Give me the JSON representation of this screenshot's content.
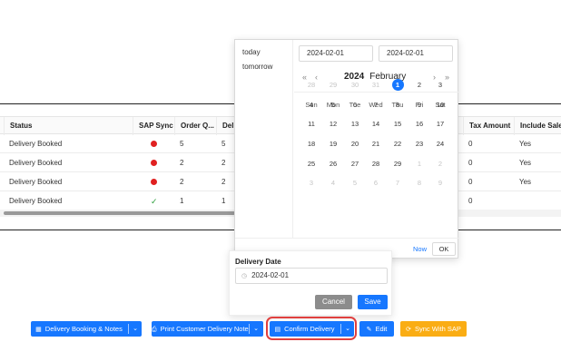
{
  "table": {
    "headers": [
      "Status",
      "SAP Sync",
      "Order Q...",
      "Deliv",
      "Tax Amount",
      "Include Sales"
    ],
    "rows": [
      {
        "status": "Delivery Booked",
        "sync": "error",
        "order_qty": "5",
        "deliv": "5",
        "tax": "0",
        "include": "Yes"
      },
      {
        "status": "Delivery Booked",
        "sync": "error",
        "order_qty": "2",
        "deliv": "2",
        "tax": "0",
        "include": "Yes"
      },
      {
        "status": "Delivery Booked",
        "sync": "error",
        "order_qty": "2",
        "deliv": "2",
        "tax": "0",
        "include": "Yes"
      },
      {
        "status": "Delivery Booked",
        "sync": "ok",
        "order_qty": "1",
        "deliv": "1",
        "tax": "0",
        "include": ""
      }
    ]
  },
  "picker": {
    "presets": [
      "today",
      "tomorrow"
    ],
    "range_start": "2024-02-01",
    "range_end": "2024-02-01",
    "year": "2024",
    "month": "February",
    "nav": {
      "prev_year": "«",
      "prev_month": "‹",
      "next_month": "›",
      "next_year": "»"
    },
    "weekdays": [
      "Sun",
      "Mon",
      "Tue",
      "Wed",
      "Thu",
      "Fri",
      "Sat"
    ],
    "weeks": [
      [
        "28",
        "29",
        "30",
        "31",
        "1",
        "2",
        "3"
      ],
      [
        "4",
        "5",
        "6",
        "7",
        "8",
        "9",
        "10"
      ],
      [
        "11",
        "12",
        "13",
        "14",
        "15",
        "16",
        "17"
      ],
      [
        "18",
        "19",
        "20",
        "21",
        "22",
        "23",
        "24"
      ],
      [
        "25",
        "26",
        "27",
        "28",
        "29",
        "1",
        "2"
      ],
      [
        "3",
        "4",
        "5",
        "6",
        "7",
        "8",
        "9"
      ]
    ],
    "selected_day": "1",
    "now_label": "Now",
    "ok_label": "OK"
  },
  "panel": {
    "label": "Delivery Date",
    "value": "2024-02-01",
    "cancel_label": "Cancel",
    "save_label": "Save"
  },
  "toolbar": {
    "delivery_booking": "Delivery Booking & Notes",
    "print_note": "Print Customer Delivery Note",
    "confirm_delivery": "Confirm Delivery",
    "edit": "Edit",
    "sync_sap": "Sync With SAP"
  },
  "colors": {
    "primary": "#1677ff",
    "warning": "#faad14",
    "error_dot": "#e02020",
    "success_check": "#2a9d3a",
    "highlight_ring": "#e0403f"
  },
  "icons": {
    "delivery_booking": "calendar-icon",
    "print_note": "printer-icon",
    "confirm_delivery": "document-icon",
    "edit": "edit-icon",
    "sync_sap": "sync-icon",
    "panel_input": "clock-icon"
  }
}
